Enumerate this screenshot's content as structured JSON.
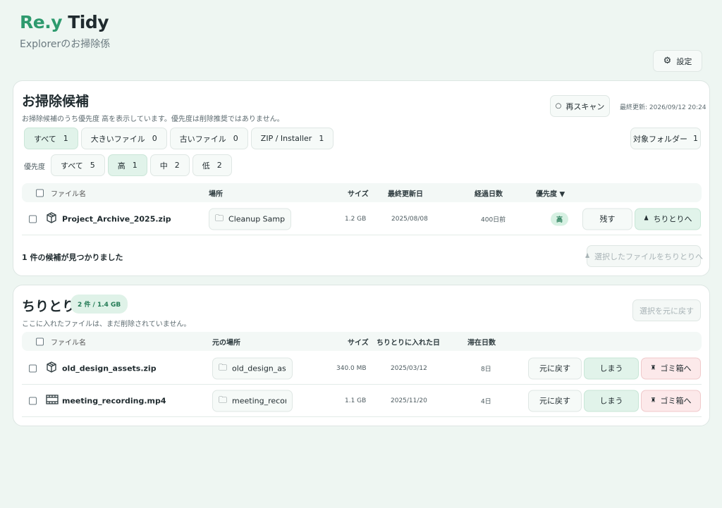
{
  "app": {
    "brand_accent": "Re.y",
    "brand_rest": "Tidy",
    "subtitle": "Explorerのお掃除係"
  },
  "settings": {
    "label": "設定",
    "icon": "gear-icon"
  },
  "candidates": {
    "title": "お掃除候補",
    "description": "お掃除候補のうち優先度 高を表示しています。優先度は削除推奨ではありません。",
    "rescan_label": "再スキャン",
    "last_updated": "最終更新: 2026/09/12 20:24",
    "target_folder_label": "対象フォルダー",
    "target_folder_count": "1",
    "filters": [
      {
        "label": "すべて",
        "count": "1"
      },
      {
        "label": "大きいファイル",
        "count": "0"
      },
      {
        "label": "古いファイル",
        "count": "0"
      },
      {
        "label": "ZIP / Installer",
        "count": "1"
      }
    ],
    "priority_label": "優先度",
    "priority_filters": [
      {
        "label": "すべて",
        "count": "5"
      },
      {
        "label": "高",
        "count": "1"
      },
      {
        "label": "中",
        "count": "2"
      },
      {
        "label": "低",
        "count": "2"
      }
    ],
    "columns": {
      "filename": "ファイル名",
      "location": "場所",
      "size": "サイズ",
      "modified": "最終更新日",
      "elapsed": "経過日数",
      "priority": "優先度 ▼"
    },
    "rows": [
      {
        "filename": "Project_Archive_2025.zip",
        "location": "Cleanup Samples",
        "size": "1.2 GB",
        "modified": "2025/08/08",
        "elapsed": "400日前",
        "priority": "高",
        "keep_label": "残す",
        "dust_label": "ちりとりへ"
      }
    ],
    "found_text": "1 件の候補が見つかりました",
    "move_selected_label": "選択したファイルをちりとりへ"
  },
  "dustpan": {
    "title": "ちりとり",
    "badge": "2 件 / 1.4 GB",
    "description": "ここに入れたファイルは、まだ削除されていません。",
    "restore_selected_label": "選択を元に戻す",
    "columns": {
      "filename": "ファイル名",
      "original_location": "元の場所",
      "size": "サイズ",
      "added_date": "ちりとりに入れた日",
      "stay_days": "滞在日数"
    },
    "rows": [
      {
        "filename": "old_design_assets.zip",
        "location": "old_design_assets",
        "size": "340.0 MB",
        "added": "2025/03/12",
        "days": "8日",
        "restore_label": "元に戻す",
        "store_label": "しまう",
        "trash_label": "ゴミ箱へ",
        "icon": "package-icon"
      },
      {
        "filename": "meeting_recording.mp4",
        "location": "meeting_recording",
        "size": "1.1 GB",
        "added": "2025/11/20",
        "days": "4日",
        "restore_label": "元に戻す",
        "store_label": "しまう",
        "trash_label": "ゴミ箱へ",
        "icon": "film-icon"
      }
    ]
  }
}
